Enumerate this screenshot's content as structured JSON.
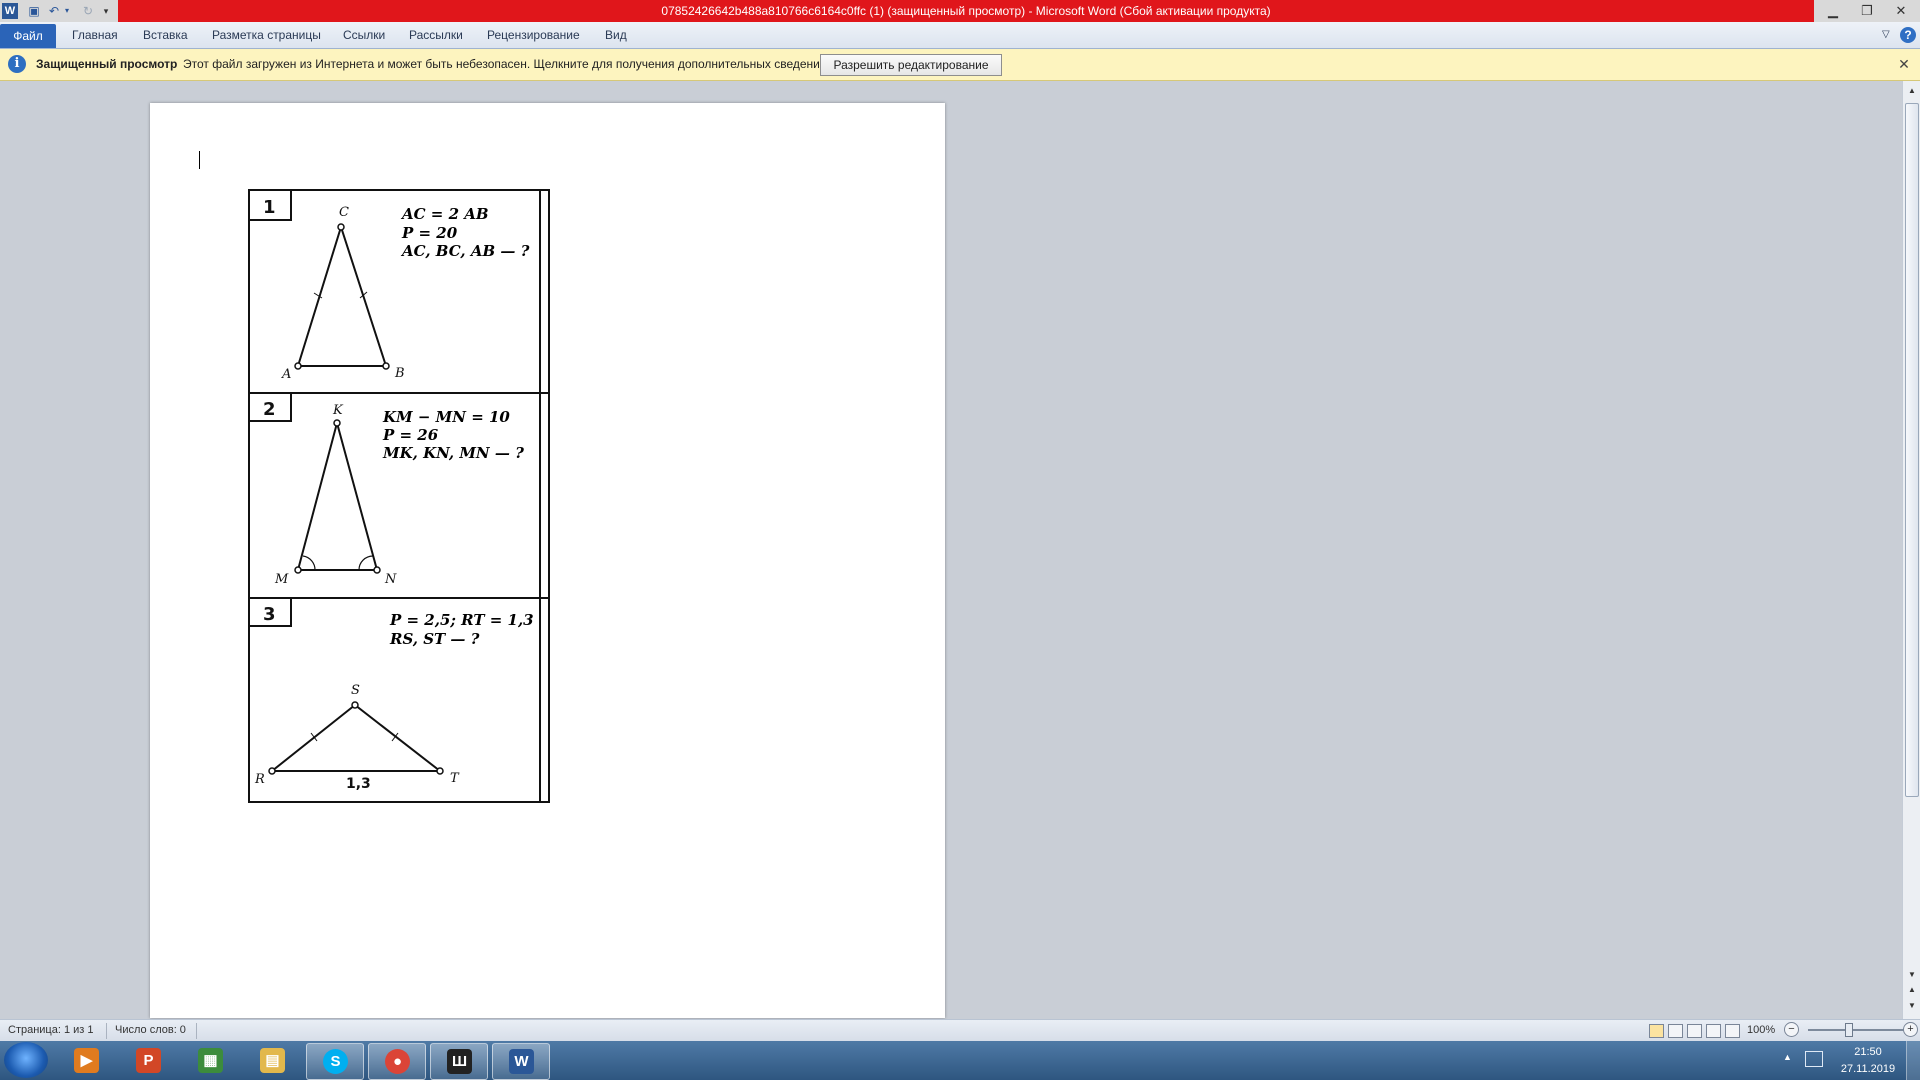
{
  "window": {
    "title": "07852426642b488a810766c6164c0ffc (1) (защищенный просмотр)  -  Microsoft Word (Сбой активации продукта)",
    "app_icon_letter": "W"
  },
  "ribbon": {
    "tabs": [
      "Файл",
      "Главная",
      "Вставка",
      "Разметка страницы",
      "Ссылки",
      "Рассылки",
      "Рецензирование",
      "Вид"
    ]
  },
  "protected_view": {
    "title": "Защищенный просмотр",
    "message": "Этот файл загружен из Интернета и может быть небезопасен. Щелкните для получения дополнительных сведений.",
    "button": "Разрешить редактирование"
  },
  "document": {
    "problems": [
      {
        "number": "1",
        "lines": [
          "AC = 2 AB",
          "P = 20",
          "AC, BC, AB — ?"
        ],
        "vertices": [
          "A",
          "B",
          "C"
        ]
      },
      {
        "number": "2",
        "lines": [
          "KM − MN = 10",
          "P = 26",
          "MK, KN, MN — ?"
        ],
        "vertices": [
          "K",
          "M",
          "N"
        ]
      },
      {
        "number": "3",
        "lines": [
          "P = 2,5; RT = 1,3",
          "RS, ST — ?"
        ],
        "vertices": [
          "S",
          "R",
          "T"
        ],
        "side_label": "1,3"
      }
    ]
  },
  "status": {
    "page": "Страница: 1 из 1",
    "words": "Число слов: 0",
    "zoom": "100%"
  },
  "taskbar": {
    "apps": [
      {
        "name": "media-player",
        "letter": "▶",
        "color": "#e07b1f"
      },
      {
        "name": "powerpoint",
        "letter": "P",
        "color": "#d24726"
      },
      {
        "name": "rubik-cube",
        "letter": "▦",
        "color": "#3c8c3c"
      },
      {
        "name": "file-explorer",
        "letter": "▤",
        "color": "#e2b84c"
      },
      {
        "name": "skype",
        "letter": "S",
        "color": "#00aff0"
      },
      {
        "name": "chrome",
        "letter": "●",
        "color": "#db4437"
      },
      {
        "name": "app-dark",
        "letter": "Ш",
        "color": "#222222"
      },
      {
        "name": "word",
        "letter": "W",
        "color": "#2b5797"
      }
    ],
    "time": "21:50",
    "date": "27.11.2019"
  },
  "colors": {
    "title_bar": "#e0161b",
    "file_tab": "#2b64b8",
    "protected_bar": "#fdf4bf"
  }
}
